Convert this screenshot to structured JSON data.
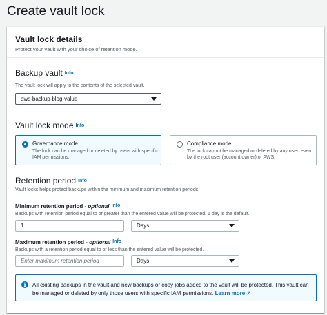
{
  "page": {
    "title": "Create vault lock"
  },
  "card": {
    "title": "Vault lock details",
    "description": "Protect your vault with your choice of retention mode."
  },
  "backup_vault": {
    "label": "Backup vault",
    "info": "Info",
    "description": "The vault lock will apply to the contents of the selected vault.",
    "selected": "aws-backup-blog-value"
  },
  "lock_mode": {
    "label": "Vault lock mode",
    "info": "Info",
    "options": [
      {
        "title": "Governance mode",
        "description": "The lock can be managed or deleted by users with specific IAM permissions.",
        "selected": true
      },
      {
        "title": "Compliance mode",
        "description": "The lock cannot be managed or deleted by any user, even by the root user (account owner) or AWS.",
        "selected": false
      }
    ]
  },
  "retention": {
    "label": "Retention period",
    "info": "Info",
    "description": "Vault locks helps protect backups within the minimum and maximum retention periods.",
    "min": {
      "label": "Minimum retention period - ",
      "optional": "optional",
      "info": "Info",
      "description": "Backups with retention period equal to or greater than the entered value will be protected. 1 day is the default.",
      "value": "1",
      "unit": "Days"
    },
    "max": {
      "label": "Maximum retention period - ",
      "optional": "optional",
      "info": "Info",
      "description": "Backups with a retention period equal to or less than the entered value will be protected.",
      "placeholder": "Enter maximum retention period",
      "unit": "Days"
    }
  },
  "alert": {
    "icon": "info-icon",
    "text": "All existing backups in the vault and new backups or copy jobs added to the vault will be protected. This vault can be managed or deleted by only those users with specific IAM permissions.",
    "link": "Learn more"
  }
}
